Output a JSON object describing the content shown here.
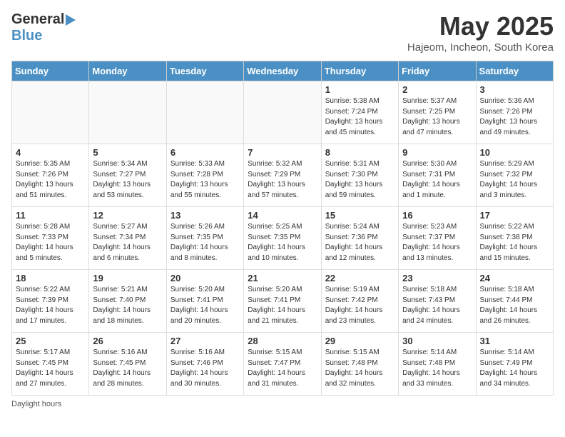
{
  "header": {
    "logo_general": "General",
    "logo_blue": "Blue",
    "month_title": "May 2025",
    "location": "Hajeom, Incheon, South Korea"
  },
  "days_of_week": [
    "Sunday",
    "Monday",
    "Tuesday",
    "Wednesday",
    "Thursday",
    "Friday",
    "Saturday"
  ],
  "weeks": [
    [
      {
        "day": "",
        "info": ""
      },
      {
        "day": "",
        "info": ""
      },
      {
        "day": "",
        "info": ""
      },
      {
        "day": "",
        "info": ""
      },
      {
        "day": "1",
        "info": "Sunrise: 5:38 AM\nSunset: 7:24 PM\nDaylight: 13 hours\nand 45 minutes."
      },
      {
        "day": "2",
        "info": "Sunrise: 5:37 AM\nSunset: 7:25 PM\nDaylight: 13 hours\nand 47 minutes."
      },
      {
        "day": "3",
        "info": "Sunrise: 5:36 AM\nSunset: 7:26 PM\nDaylight: 13 hours\nand 49 minutes."
      }
    ],
    [
      {
        "day": "4",
        "info": "Sunrise: 5:35 AM\nSunset: 7:26 PM\nDaylight: 13 hours\nand 51 minutes."
      },
      {
        "day": "5",
        "info": "Sunrise: 5:34 AM\nSunset: 7:27 PM\nDaylight: 13 hours\nand 53 minutes."
      },
      {
        "day": "6",
        "info": "Sunrise: 5:33 AM\nSunset: 7:28 PM\nDaylight: 13 hours\nand 55 minutes."
      },
      {
        "day": "7",
        "info": "Sunrise: 5:32 AM\nSunset: 7:29 PM\nDaylight: 13 hours\nand 57 minutes."
      },
      {
        "day": "8",
        "info": "Sunrise: 5:31 AM\nSunset: 7:30 PM\nDaylight: 13 hours\nand 59 minutes."
      },
      {
        "day": "9",
        "info": "Sunrise: 5:30 AM\nSunset: 7:31 PM\nDaylight: 14 hours\nand 1 minute."
      },
      {
        "day": "10",
        "info": "Sunrise: 5:29 AM\nSunset: 7:32 PM\nDaylight: 14 hours\nand 3 minutes."
      }
    ],
    [
      {
        "day": "11",
        "info": "Sunrise: 5:28 AM\nSunset: 7:33 PM\nDaylight: 14 hours\nand 5 minutes."
      },
      {
        "day": "12",
        "info": "Sunrise: 5:27 AM\nSunset: 7:34 PM\nDaylight: 14 hours\nand 6 minutes."
      },
      {
        "day": "13",
        "info": "Sunrise: 5:26 AM\nSunset: 7:35 PM\nDaylight: 14 hours\nand 8 minutes."
      },
      {
        "day": "14",
        "info": "Sunrise: 5:25 AM\nSunset: 7:35 PM\nDaylight: 14 hours\nand 10 minutes."
      },
      {
        "day": "15",
        "info": "Sunrise: 5:24 AM\nSunset: 7:36 PM\nDaylight: 14 hours\nand 12 minutes."
      },
      {
        "day": "16",
        "info": "Sunrise: 5:23 AM\nSunset: 7:37 PM\nDaylight: 14 hours\nand 13 minutes."
      },
      {
        "day": "17",
        "info": "Sunrise: 5:22 AM\nSunset: 7:38 PM\nDaylight: 14 hours\nand 15 minutes."
      }
    ],
    [
      {
        "day": "18",
        "info": "Sunrise: 5:22 AM\nSunset: 7:39 PM\nDaylight: 14 hours\nand 17 minutes."
      },
      {
        "day": "19",
        "info": "Sunrise: 5:21 AM\nSunset: 7:40 PM\nDaylight: 14 hours\nand 18 minutes."
      },
      {
        "day": "20",
        "info": "Sunrise: 5:20 AM\nSunset: 7:41 PM\nDaylight: 14 hours\nand 20 minutes."
      },
      {
        "day": "21",
        "info": "Sunrise: 5:20 AM\nSunset: 7:41 PM\nDaylight: 14 hours\nand 21 minutes."
      },
      {
        "day": "22",
        "info": "Sunrise: 5:19 AM\nSunset: 7:42 PM\nDaylight: 14 hours\nand 23 minutes."
      },
      {
        "day": "23",
        "info": "Sunrise: 5:18 AM\nSunset: 7:43 PM\nDaylight: 14 hours\nand 24 minutes."
      },
      {
        "day": "24",
        "info": "Sunrise: 5:18 AM\nSunset: 7:44 PM\nDaylight: 14 hours\nand 26 minutes."
      }
    ],
    [
      {
        "day": "25",
        "info": "Sunrise: 5:17 AM\nSunset: 7:45 PM\nDaylight: 14 hours\nand 27 minutes."
      },
      {
        "day": "26",
        "info": "Sunrise: 5:16 AM\nSunset: 7:45 PM\nDaylight: 14 hours\nand 28 minutes."
      },
      {
        "day": "27",
        "info": "Sunrise: 5:16 AM\nSunset: 7:46 PM\nDaylight: 14 hours\nand 30 minutes."
      },
      {
        "day": "28",
        "info": "Sunrise: 5:15 AM\nSunset: 7:47 PM\nDaylight: 14 hours\nand 31 minutes."
      },
      {
        "day": "29",
        "info": "Sunrise: 5:15 AM\nSunset: 7:48 PM\nDaylight: 14 hours\nand 32 minutes."
      },
      {
        "day": "30",
        "info": "Sunrise: 5:14 AM\nSunset: 7:48 PM\nDaylight: 14 hours\nand 33 minutes."
      },
      {
        "day": "31",
        "info": "Sunrise: 5:14 AM\nSunset: 7:49 PM\nDaylight: 14 hours\nand 34 minutes."
      }
    ]
  ],
  "footer": {
    "daylight_hours_label": "Daylight hours"
  },
  "colors": {
    "header_bg": "#4a90c4",
    "accent_blue": "#4a90c4"
  }
}
